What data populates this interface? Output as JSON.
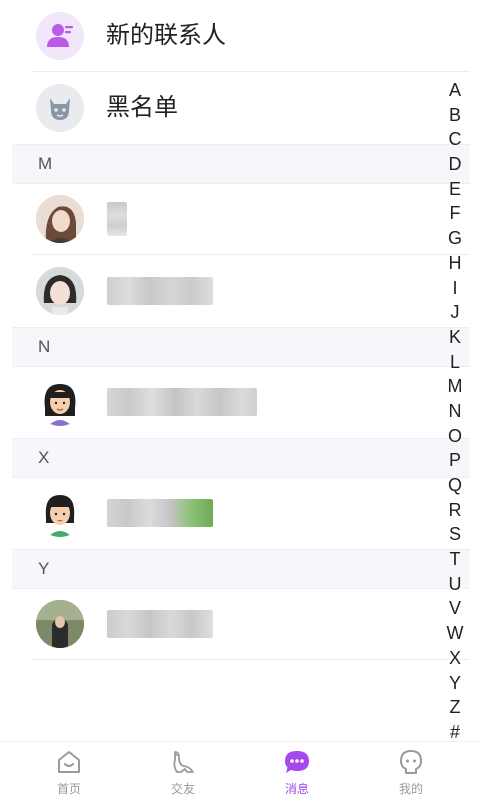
{
  "list": {
    "new_contacts_label": "新的联系人",
    "blacklist_label": "黑名单"
  },
  "sections": {
    "m": "M",
    "n": "N",
    "x": "X",
    "y": "Y"
  },
  "index": [
    "A",
    "B",
    "C",
    "D",
    "E",
    "F",
    "G",
    "H",
    "I",
    "J",
    "K",
    "L",
    "M",
    "N",
    "O",
    "P",
    "Q",
    "R",
    "S",
    "T",
    "U",
    "V",
    "W",
    "X",
    "Y",
    "Z",
    "#"
  ],
  "tabbar": {
    "home": "首页",
    "friends": "交友",
    "messages": "消息",
    "mine": "我的"
  },
  "colors": {
    "accent": "#a647f0",
    "inactive_icon": "#9a9a9a",
    "section_bg": "#f7f7fb"
  }
}
